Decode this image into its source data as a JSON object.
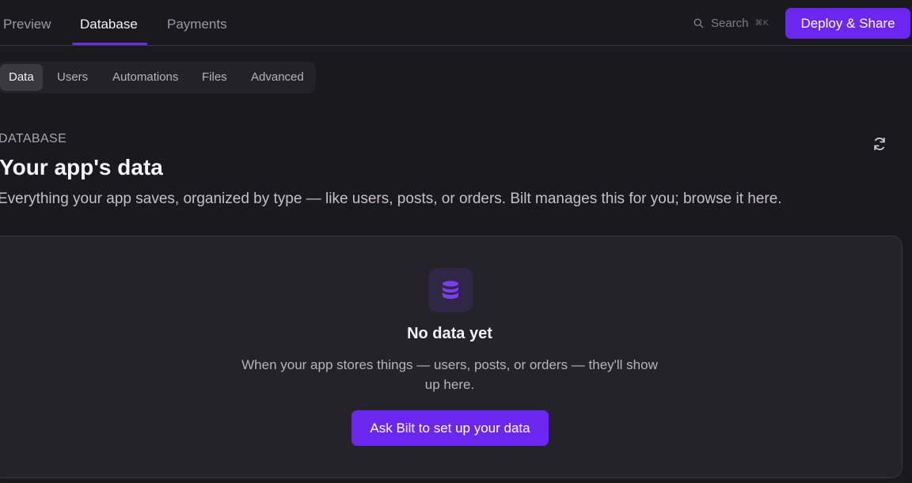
{
  "header": {
    "tabs": [
      {
        "label": "Preview",
        "active": false
      },
      {
        "label": "Database",
        "active": true
      },
      {
        "label": "Payments",
        "active": false
      }
    ],
    "search": {
      "label": "Search",
      "shortcut": "⌘K",
      "icon": "search-icon"
    },
    "deploy_label": "Deploy & Share"
  },
  "subtabs": [
    {
      "label": "Data",
      "active": true
    },
    {
      "label": "Users",
      "active": false
    },
    {
      "label": "Automations",
      "active": false
    },
    {
      "label": "Files",
      "active": false
    },
    {
      "label": "Advanced",
      "active": false
    }
  ],
  "page": {
    "kicker": "DATABASE",
    "title": "Your app's data",
    "description": "Everything your app saves, organized by type — like users, posts, or orders. Bilt manages this for you; browse it here.",
    "refresh_icon": "refresh-icon"
  },
  "empty_state": {
    "icon": "database-icon",
    "title": "No data yet",
    "description": "When your app stores things — users, posts, or orders — they'll show up here.",
    "cta_label": "Ask Bilt to set up your data"
  },
  "colors": {
    "accent": "#6b27f0",
    "background": "#1a191e",
    "card": "#242329"
  }
}
